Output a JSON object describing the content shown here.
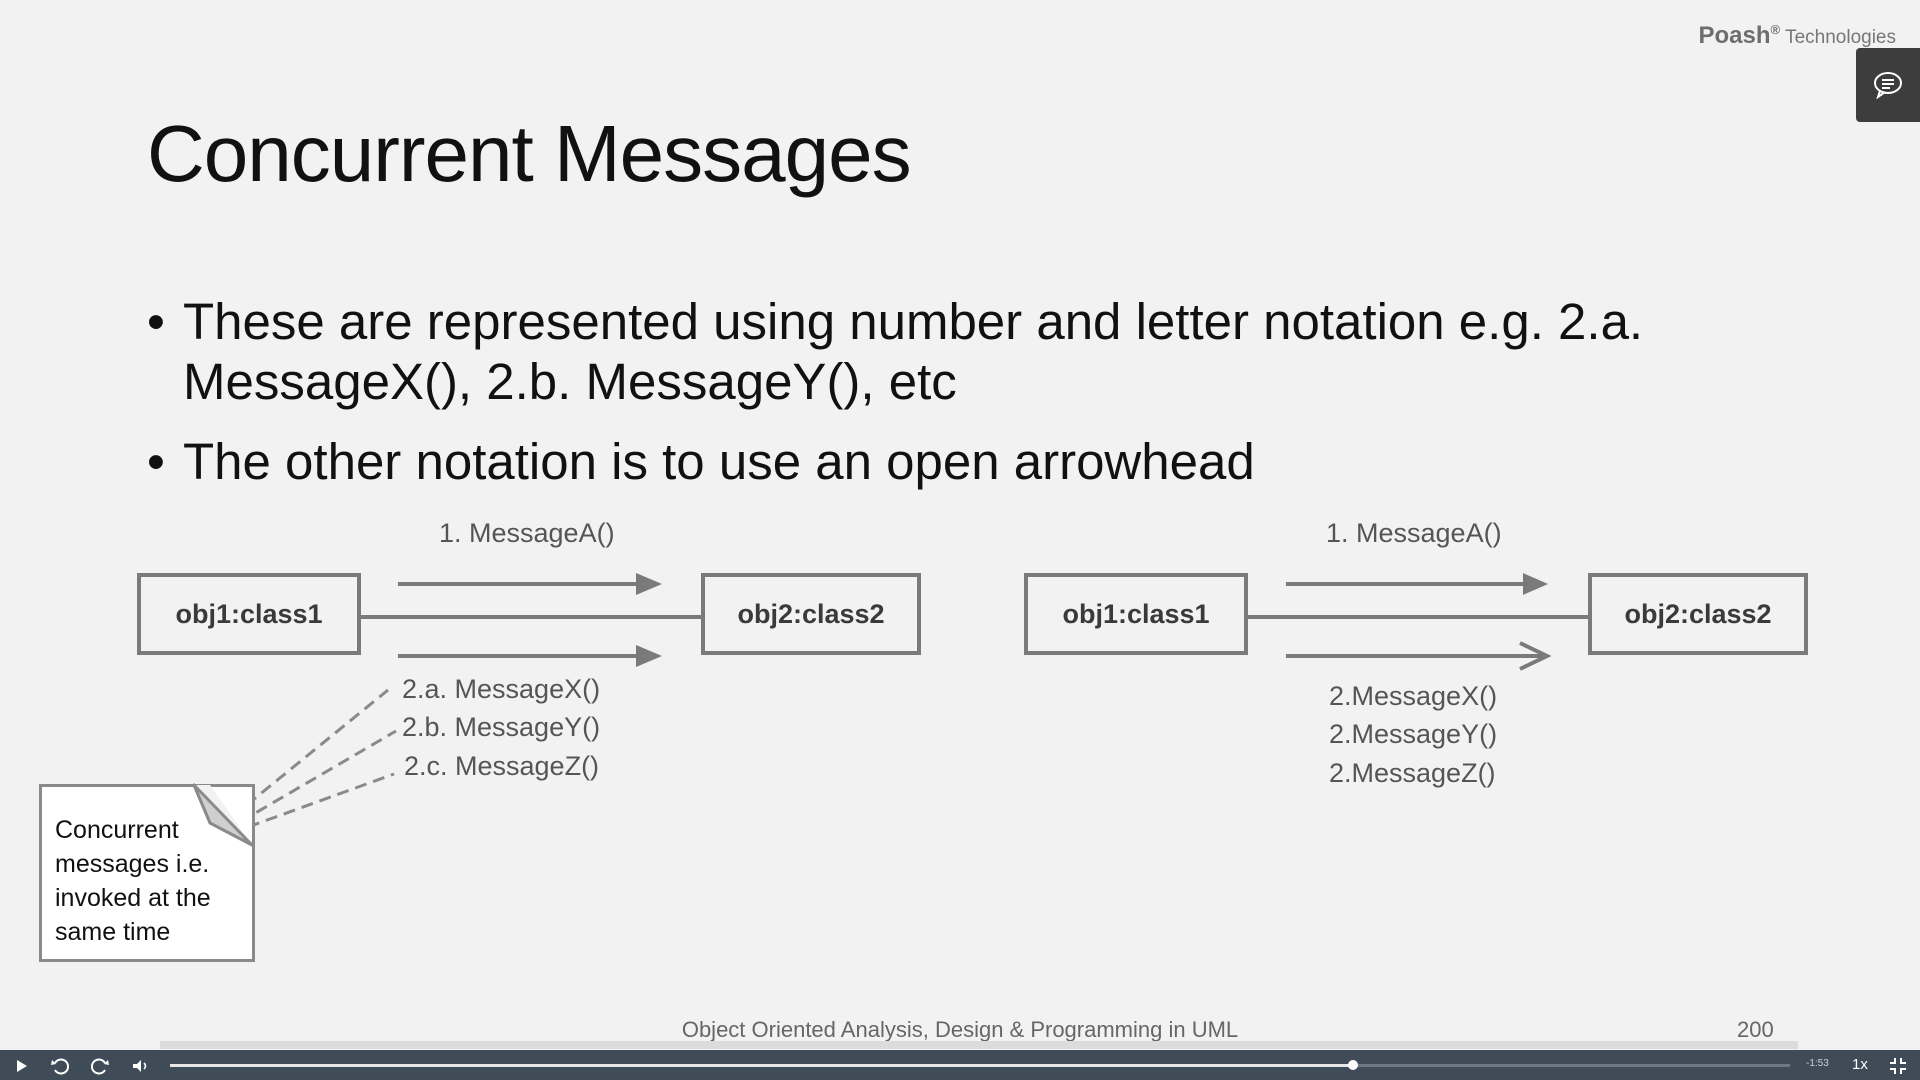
{
  "brand": {
    "name": "Poash",
    "reg": "®",
    "suffix": "Technologies"
  },
  "slide": {
    "title": "Concurrent Messages",
    "bullets": [
      {
        "marker": "•",
        "text": "These are represented using number and letter notation e.g. 2.a. MessageX(), 2.b. MessageY(), etc"
      },
      {
        "marker": "•",
        "text": "The other notation is to use an open arrowhead"
      }
    ],
    "left_diagram": {
      "obj1": "obj1:class1",
      "obj2": "obj2:class2",
      "msg1": "1. MessageA()",
      "messages": [
        "2.a. MessageX()",
        "2.b. MessageY()",
        "2.c. MessageZ()"
      ]
    },
    "right_diagram": {
      "obj1": "obj1:class1",
      "obj2": "obj2:class2",
      "msg1": "1. MessageA()",
      "messages": [
        "2.MessageX()",
        "2.MessageY()",
        "2.MessageZ()"
      ]
    },
    "note": "Concurrent messages i.e. invoked at the same time",
    "footer": "Object Oriented Analysis, Design & Programming in UML",
    "page_number": "200"
  },
  "player": {
    "progress_fraction": 0.73,
    "time_remaining": "-1:53",
    "speed": "1x",
    "icons": [
      "play-icon",
      "rewind-icon",
      "forward-icon",
      "volume-icon",
      "fullscreen-exit-icon",
      "chat-icon"
    ]
  }
}
